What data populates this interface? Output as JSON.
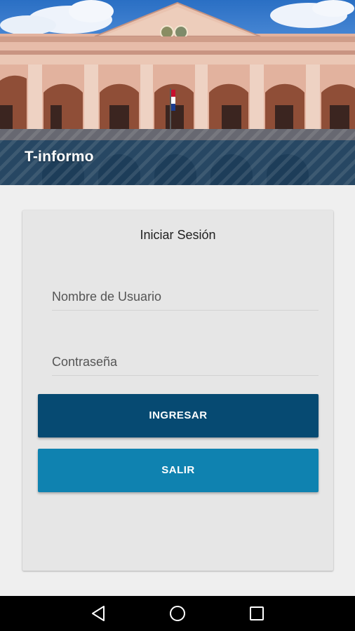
{
  "app": {
    "title": "T-informo"
  },
  "login_card": {
    "title": "Iniciar Sesión",
    "username_placeholder": "Nombre de Usuario",
    "username_value": "",
    "password_placeholder": "Contraseña",
    "password_value": "",
    "login_button_label": "INGRESAR",
    "exit_button_label": "SALIR"
  },
  "navbar": {
    "icons": [
      "back-icon",
      "home-icon",
      "recent-apps-icon"
    ]
  },
  "colors": {
    "primary_dark": "#064a72",
    "primary": "#0f82b0",
    "background": "#efefef",
    "card": "#e6e6e6"
  }
}
